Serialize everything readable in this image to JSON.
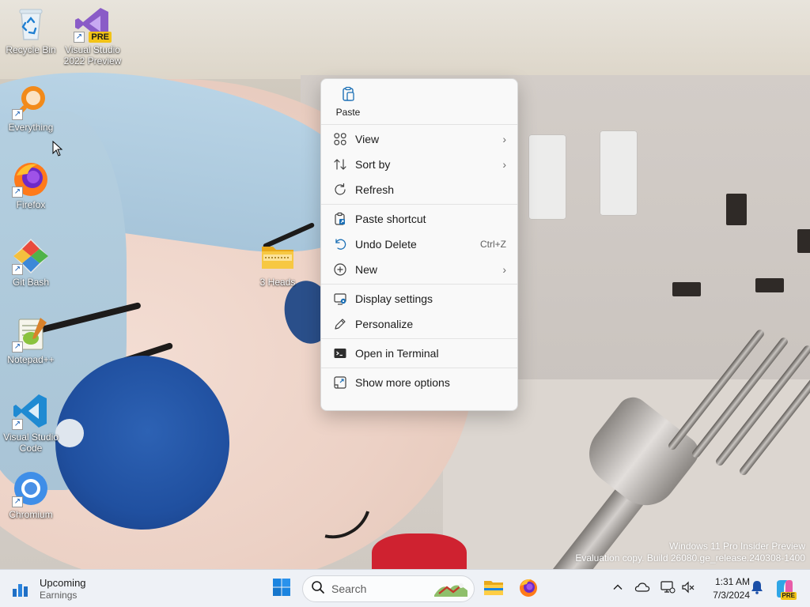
{
  "desktop": {
    "icons": [
      {
        "label": "Recycle Bin",
        "icon": "recycle-bin-icon"
      },
      {
        "label": "Visual Studio 2022 Preview",
        "label_line1": "Visual Studio",
        "label_line2": "2022 Preview",
        "icon": "visual-studio-preview-icon",
        "badge": "PRE"
      },
      {
        "label": "Everything",
        "icon": "everything-search-icon"
      },
      {
        "label": "Firefox",
        "icon": "firefox-icon"
      },
      {
        "label": "Git Bash",
        "icon": "git-bash-icon"
      },
      {
        "label": "Notepad++",
        "icon": "notepad-plus-plus-icon"
      },
      {
        "label": "Visual Studio Code",
        "label_line1": "Visual Studio",
        "label_line2": "Code",
        "icon": "vscode-icon"
      },
      {
        "label": "Chromium",
        "icon": "chromium-icon"
      },
      {
        "label": "3 Heads",
        "icon": "zip-folder-icon"
      }
    ]
  },
  "context_menu": {
    "top_actions": [
      {
        "label": "Paste",
        "icon": "paste-icon"
      }
    ],
    "sections": [
      [
        {
          "label": "View",
          "icon": "grid-icon",
          "submenu": true
        },
        {
          "label": "Sort by",
          "icon": "sort-icon",
          "submenu": true
        },
        {
          "label": "Refresh",
          "icon": "refresh-icon"
        }
      ],
      [
        {
          "label": "Paste shortcut",
          "icon": "paste-shortcut-icon"
        },
        {
          "label": "Undo Delete",
          "icon": "undo-icon",
          "shortcut": "Ctrl+Z"
        },
        {
          "label": "New",
          "icon": "plus-circle-icon",
          "submenu": true
        }
      ],
      [
        {
          "label": "Display settings",
          "icon": "display-settings-icon"
        },
        {
          "label": "Personalize",
          "icon": "pen-icon"
        }
      ],
      [
        {
          "label": "Open in Terminal",
          "icon": "terminal-icon"
        }
      ],
      [
        {
          "label": "Show more options",
          "icon": "show-more-icon"
        }
      ]
    ]
  },
  "watermark": {
    "line1": "Windows 11 Pro Insider Preview",
    "line2": "Evaluation copy. Build 26080.ge_release.240308-1400"
  },
  "taskbar": {
    "widget": {
      "title": "Upcoming",
      "subtitle": "Earnings",
      "icon": "earnings-chart-icon"
    },
    "search_placeholder": "Search",
    "pinned": [
      "start-icon",
      "file-explorer-icon",
      "firefox-icon"
    ],
    "tray": [
      "chevron-up-icon",
      "onedrive-icon",
      "network-icon",
      "volume-muted-icon"
    ],
    "clock": {
      "time": "1:31 AM",
      "date": "7/3/2024"
    },
    "notification_icon": "bell-icon",
    "copilot_badge": "PRE"
  },
  "colors": {
    "accent": "#0067c0",
    "menu_bg": "#f9f9f9",
    "taskbar_bg": "#eef1f6"
  }
}
